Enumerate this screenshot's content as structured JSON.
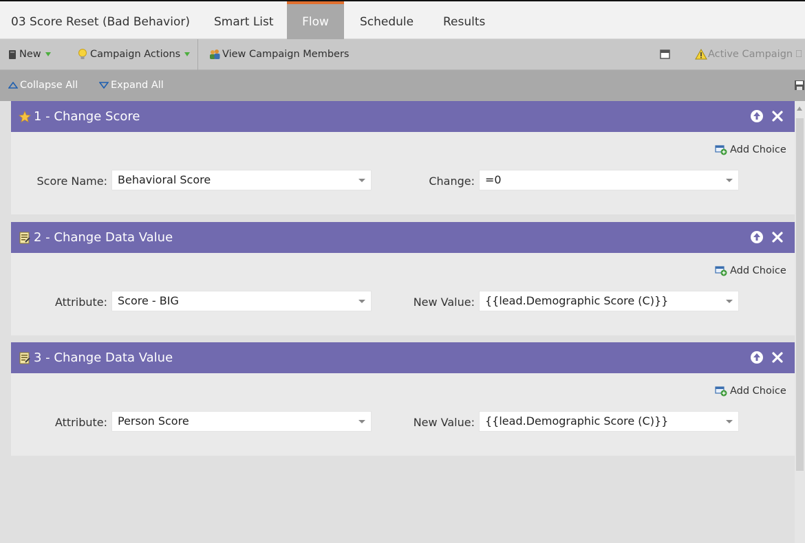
{
  "tabs": {
    "campaign_name": "03 Score Reset (Bad Behavior)",
    "items": [
      "Smart List",
      "Flow",
      "Schedule",
      "Results"
    ],
    "active": "Flow"
  },
  "toolbar": {
    "new_label": "New",
    "campaign_actions_label": "Campaign Actions",
    "view_members_label": "View Campaign Members",
    "status_label": "Active Campaign ⎕ ch"
  },
  "collapse_bar": {
    "collapse_label": "Collapse All",
    "expand_label": "Expand All"
  },
  "flow_steps": [
    {
      "title": "1 - Change Score",
      "icon": "star-icon",
      "add_choice": "Add Choice",
      "field1_label": "Score Name:",
      "field1_value": "Behavioral Score",
      "field2_label": "Change:",
      "field2_value": "=0"
    },
    {
      "title": "2 - Change Data Value",
      "icon": "data-value-icon",
      "add_choice": "Add Choice",
      "field1_label": "Attribute:",
      "field1_value": "Score - BIG",
      "field2_label": "New Value:",
      "field2_value": "{{lead.Demographic Score (C)}}"
    },
    {
      "title": "3 - Change Data Value",
      "icon": "data-value-icon",
      "add_choice": "Add Choice",
      "field1_label": "Attribute:",
      "field1_value": "Person Score",
      "field2_label": "New Value:",
      "field2_value": "{{lead.Demographic Score (C)}}"
    }
  ],
  "colors": {
    "step_header": "#716aaf",
    "active_tab": "#a9a9a9",
    "active_tab_accent": "#e1702f"
  }
}
